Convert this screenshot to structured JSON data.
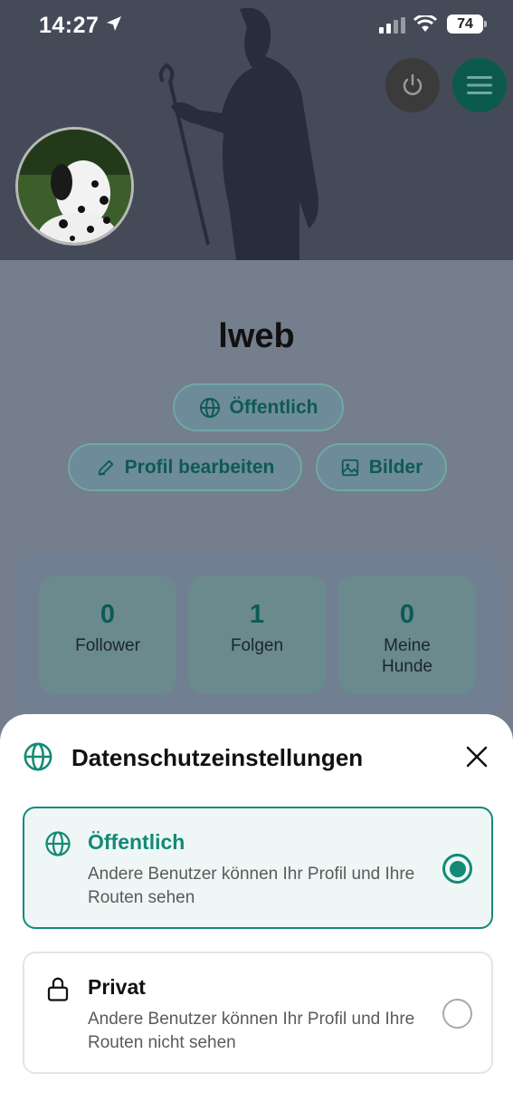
{
  "status_bar": {
    "time": "14:27",
    "battery": "74"
  },
  "profile": {
    "username": "lweb",
    "visibility_chip": "Öffentlich",
    "edit_label": "Profil bearbeiten",
    "images_label": "Bilder"
  },
  "stats": [
    {
      "value": "0",
      "label": "Follower"
    },
    {
      "value": "1",
      "label": "Folgen"
    },
    {
      "value": "0",
      "label": "Meine Hunde"
    }
  ],
  "sheet": {
    "title": "Datenschutzeinstellungen",
    "options": [
      {
        "title": "Öffentlich",
        "description": "Andere Benutzer können Ihr Profil und Ihre Routen sehen",
        "selected": true,
        "icon": "globe-icon"
      },
      {
        "title": "Privat",
        "description": "Andere Benutzer können Ihr Profil und Ihre Routen nicht sehen",
        "selected": false,
        "icon": "lock-icon"
      }
    ]
  },
  "colors": {
    "accent": "#128a76",
    "menu_button": "#0c5a4d"
  }
}
